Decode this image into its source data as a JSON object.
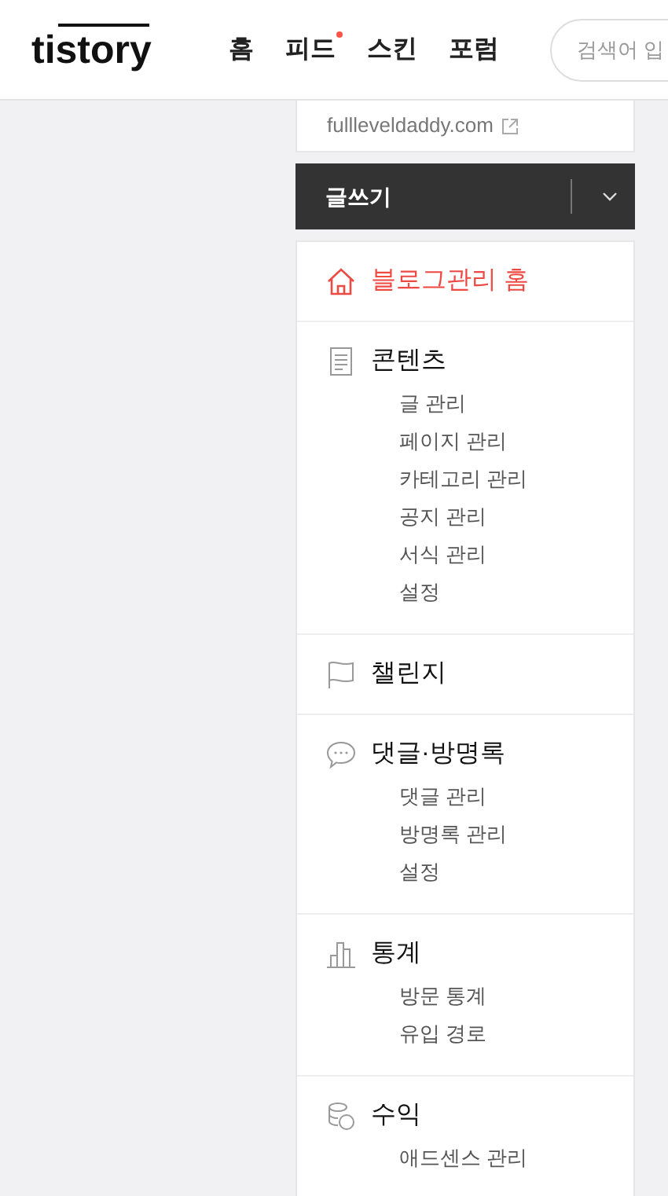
{
  "header": {
    "logo": "tistory",
    "nav": [
      {
        "label": "홈",
        "has_new": false
      },
      {
        "label": "피드",
        "has_new": true
      },
      {
        "label": "스킨",
        "has_new": false
      },
      {
        "label": "포럼",
        "has_new": false
      }
    ],
    "search": {
      "placeholder": "검색어 입"
    }
  },
  "blog_url": "fullleveldaddy.com",
  "write_button": {
    "label": "글쓰기"
  },
  "menu": [
    {
      "title": "블로그관리 홈",
      "selected": true
    },
    {
      "title": "콘텐츠",
      "selected": false,
      "items": [
        "글 관리",
        "페이지 관리",
        "카테고리 관리",
        "공지 관리",
        "서식 관리",
        "설정"
      ]
    },
    {
      "title": "챌린지",
      "selected": false
    },
    {
      "title": "댓글·방명록",
      "selected": false,
      "items": [
        "댓글 관리",
        "방명록 관리",
        "설정"
      ]
    },
    {
      "title": "통계",
      "selected": false,
      "items": [
        "방문 통계",
        "유입 경로"
      ]
    },
    {
      "title": "수익",
      "selected": false,
      "items": [
        "애드센스 관리"
      ]
    }
  ]
}
